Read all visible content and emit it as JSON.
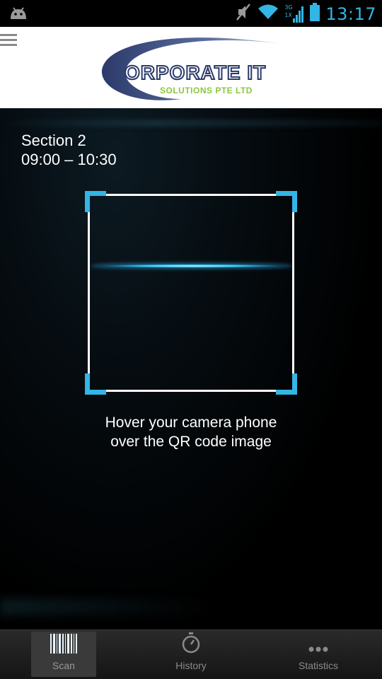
{
  "status_bar": {
    "time": "13:17",
    "network_label_top": "3G",
    "network_label_bottom": "1X",
    "icons": [
      "android-debug-icon",
      "mute-icon",
      "wifi-icon",
      "signal-icon",
      "battery-icon"
    ]
  },
  "header": {
    "logo_main": "ORPORATE IT",
    "logo_sub": "SOLUTIONS PTE LTD"
  },
  "scan": {
    "section_name": "Section 2",
    "time_range": "09:00 – 10:30",
    "instruction_line1": "Hover your camera phone",
    "instruction_line2": "over the QR code image"
  },
  "nav": {
    "items": [
      {
        "label": "Scan",
        "icon": "barcode-icon",
        "active": true
      },
      {
        "label": "History",
        "icon": "stopwatch-icon",
        "active": false
      },
      {
        "label": "Statistics",
        "icon": "dots-icon",
        "active": false
      }
    ]
  },
  "colors": {
    "accent": "#33b5e5",
    "logo_green": "#8dc63f",
    "logo_navy": "#2b3a6b"
  }
}
